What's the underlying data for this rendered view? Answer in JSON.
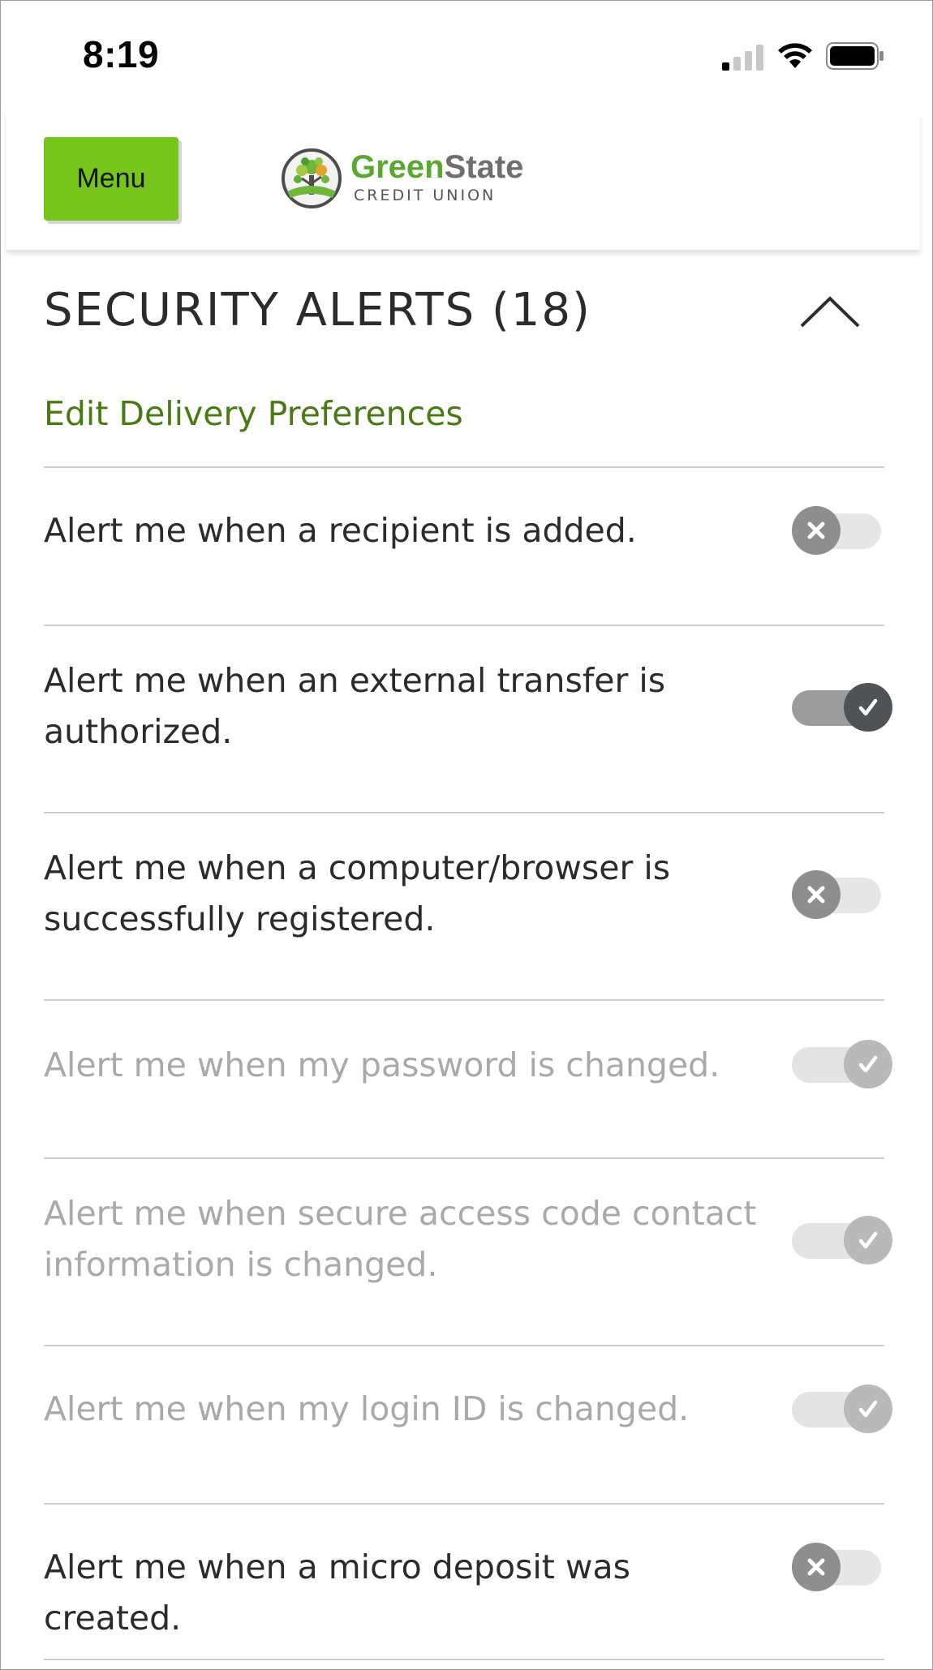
{
  "status_bar": {
    "time": "8:19",
    "icons": [
      "cellular-signal-icon",
      "wifi-icon",
      "battery-icon"
    ]
  },
  "header": {
    "menu_label": "Menu",
    "logo": {
      "name_part1": "Green",
      "name_part2": "State",
      "subtitle": "CREDIT UNION"
    }
  },
  "section": {
    "title": "SECURITY ALERTS (18)",
    "collapse_icon": "chevron-up-icon",
    "edit_link": "Edit Delivery Preferences"
  },
  "alerts": [
    {
      "text": "Alert me when a recipient is added.",
      "enabled": false,
      "disabled": false
    },
    {
      "text": "Alert me when an external transfer is authorized.",
      "enabled": true,
      "disabled": false
    },
    {
      "text": "Alert me when a computer/browser is successfully registered.",
      "enabled": false,
      "disabled": false
    },
    {
      "text": "Alert me when my password is changed.",
      "enabled": true,
      "disabled": true
    },
    {
      "text": "Alert me when secure access code contact information is changed.",
      "enabled": true,
      "disabled": true
    },
    {
      "text": "Alert me when my login ID is changed.",
      "enabled": true,
      "disabled": true
    },
    {
      "text": "Alert me when a micro deposit was created.",
      "enabled": false,
      "disabled": false
    }
  ],
  "colors": {
    "menu_button": "#76c51d",
    "link": "#4a7a14",
    "logo_green": "#59a832",
    "toggle_on_knob": "#4f5356",
    "toggle_off_knob": "#8e8e8e"
  }
}
